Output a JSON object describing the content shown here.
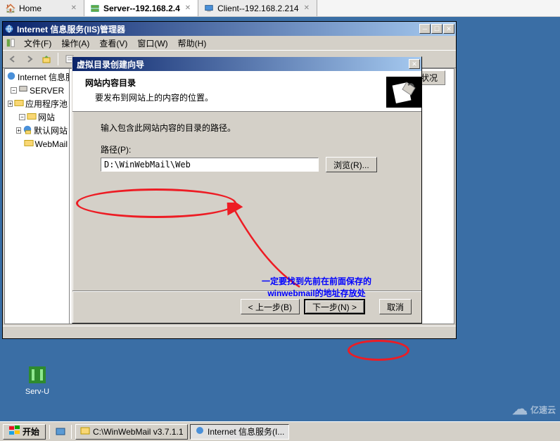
{
  "browser_tabs": {
    "home": "Home",
    "server": "Server--192.168.2.4",
    "client": "Client--192.168.2.214"
  },
  "iis": {
    "title": "Internet 信息服务(IIS)管理器",
    "menu": {
      "file": "文件(F)",
      "action": "操作(A)",
      "view": "查看(V)",
      "window": "窗口(W)",
      "help": "帮助(H)"
    },
    "tree": {
      "root": "Internet 信息服务",
      "server": "SERVER",
      "apppool": "应用程序池",
      "sites": "网站",
      "default": "默认网站",
      "webmail": "WebMail"
    },
    "right_col": "状况"
  },
  "wizard": {
    "title": "虚拟目录创建向导",
    "header_title": "网站内容目录",
    "header_sub": "要发布到网站上的内容的位置。",
    "body_prompt": "输入包含此网站内容的目录的路径。",
    "path_label": "路径(P):",
    "path_value": "D:\\WinWebMail\\Web",
    "browse": "浏览(R)...",
    "back": "< 上一步(B)",
    "next": "下一步(N) >",
    "cancel": "取消"
  },
  "annotation": {
    "line1": "一定要找到先前在前面保存的",
    "line2": "winwebmail的地址存放处"
  },
  "desktop": {
    "servu": "Serv-U"
  },
  "taskbar": {
    "start": "开始",
    "explorer": "C:\\WinWebMail v3.7.1.1",
    "iis": "Internet 信息服务(I..."
  },
  "watermark": "亿速云"
}
